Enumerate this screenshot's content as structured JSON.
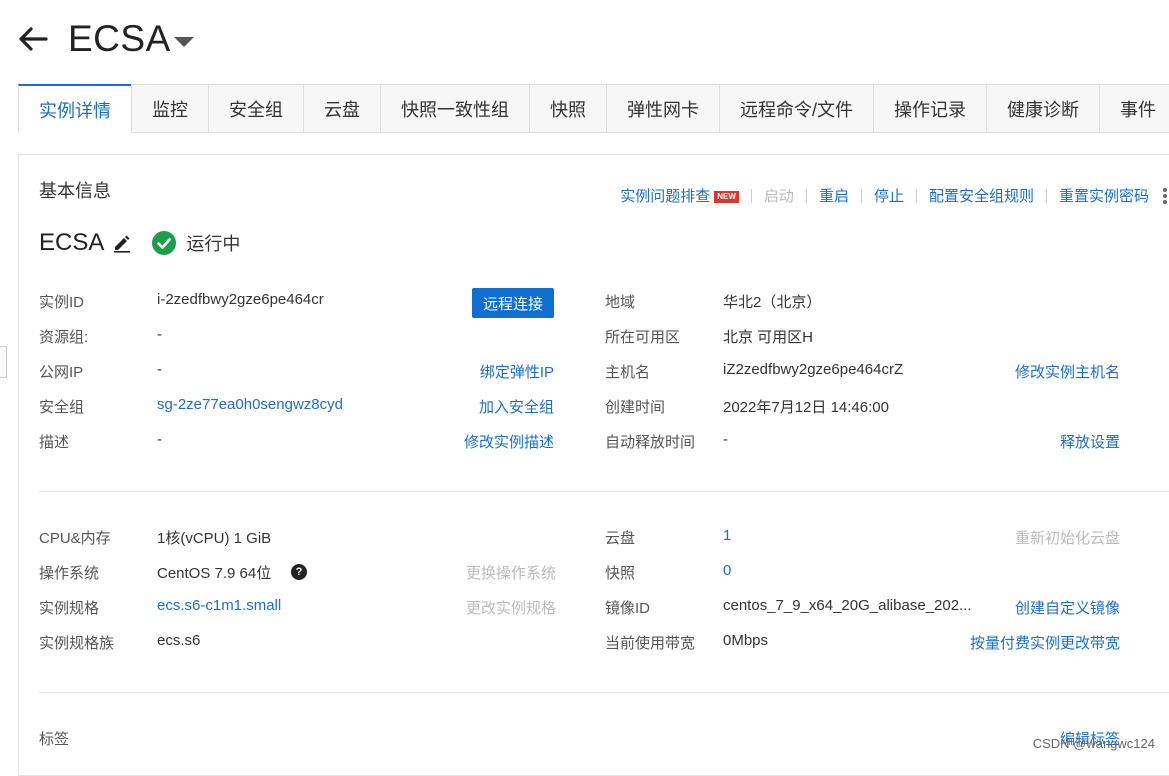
{
  "header": {
    "title": "ECSA"
  },
  "tabs": [
    {
      "label": "实例详情"
    },
    {
      "label": "监控"
    },
    {
      "label": "安全组"
    },
    {
      "label": "云盘"
    },
    {
      "label": "快照一致性组"
    },
    {
      "label": "快照"
    },
    {
      "label": "弹性网卡"
    },
    {
      "label": "远程命令/文件"
    },
    {
      "label": "操作记录"
    },
    {
      "label": "健康诊断"
    },
    {
      "label": "事件"
    }
  ],
  "section": {
    "title": "基本信息"
  },
  "actions": {
    "troubleshoot": "实例问题排查",
    "new_badge": "NEW",
    "start": "启动",
    "restart": "重启",
    "stop": "停止",
    "security_rules": "配置安全组规则",
    "reset_password": "重置实例密码"
  },
  "instance": {
    "name": "ECSA",
    "status": "运行中"
  },
  "info": {
    "instance_id_label": "实例ID",
    "instance_id": "i-2zedfbwy2gze6pe464cr",
    "remote_button": "远程连接",
    "resource_group_label": "资源组:",
    "resource_group": "-",
    "public_ip_label": "公网IP",
    "public_ip": "-",
    "bind_eip": "绑定弹性IP",
    "security_group_label": "安全组",
    "security_group": "sg-2ze77ea0h0sengwz8cyd",
    "join_sg": "加入安全组",
    "description_label": "描述",
    "description": "-",
    "edit_description": "修改实例描述",
    "region_label": "地域",
    "region": "华北2（北京）",
    "zone_label": "所在可用区",
    "zone": "北京 可用区H",
    "hostname_label": "主机名",
    "hostname": "iZ2zedfbwy2gze6pe464crZ",
    "edit_hostname": "修改实例主机名",
    "created_label": "创建时间",
    "created": "2022年7月12日 14:46:00",
    "auto_release_label": "自动释放时间",
    "auto_release": "-",
    "release_settings": "释放设置"
  },
  "config": {
    "cpu_label": "CPU&内存",
    "cpu": "1核(vCPU) 1 GiB",
    "os_label": "操作系统",
    "os": "CentOS 7.9 64位",
    "change_os": "更换操作系统",
    "spec_label": "实例规格",
    "spec": "ecs.s6-c1m1.small",
    "change_spec": "更改实例规格",
    "family_label": "实例规格族",
    "family": "ecs.s6",
    "disk_label": "云盘",
    "disk": "1",
    "reinit_disk": "重新初始化云盘",
    "snapshot_label": "快照",
    "snapshot": "0",
    "image_label": "镜像ID",
    "image": "centos_7_9_x64_20G_alibase_202...",
    "create_image": "创建自定义镜像",
    "bandwidth_label": "当前使用带宽",
    "bandwidth": "0Mbps",
    "change_bandwidth": "按量付费实例更改带宽"
  },
  "tags": {
    "label": "标签",
    "edit": "编辑标签"
  },
  "watermark": "CSDN @wangwc124",
  "colors": {
    "link": "#1a6ecb",
    "primary": "#0f6fd1",
    "status_ok": "#1e9e4a",
    "badge": "#e0342b"
  }
}
